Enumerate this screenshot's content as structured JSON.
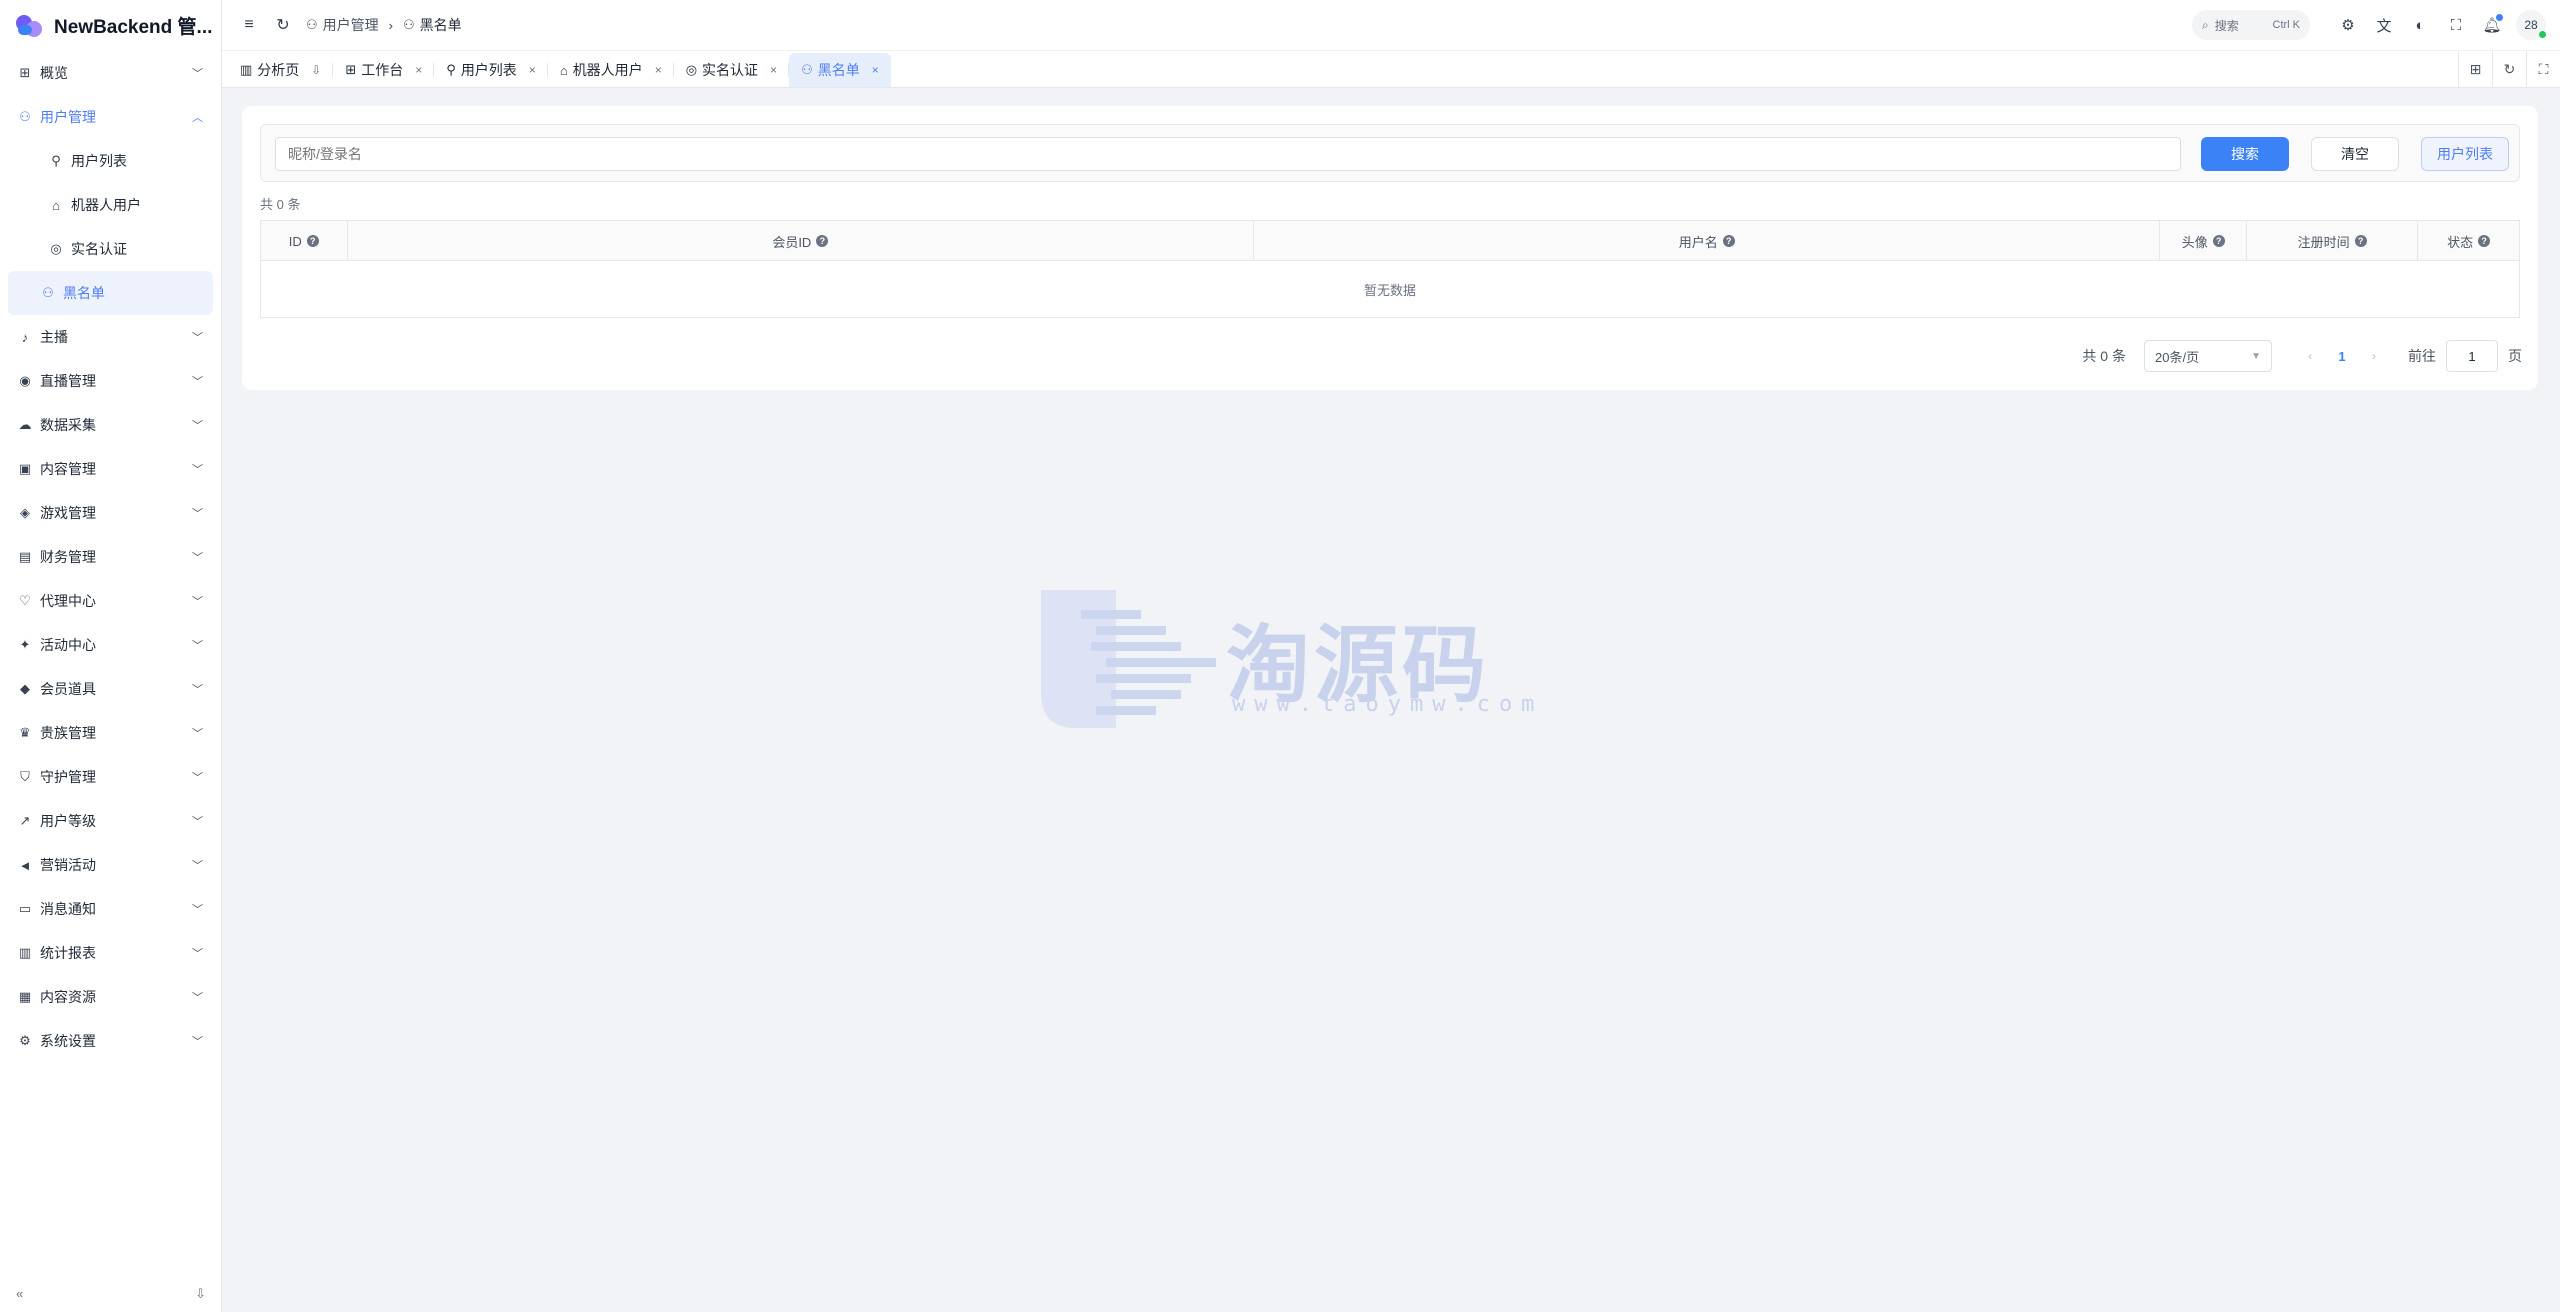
{
  "app": {
    "title": "NewBackend 管..."
  },
  "sidebar": {
    "items": [
      {
        "label": "概览",
        "icon": "⊞",
        "icon_name": "dashboard-icon",
        "name": "overview"
      },
      {
        "label": "用户管理",
        "icon": "⚇",
        "icon_name": "user-icon",
        "name": "user-management",
        "open": true,
        "children": [
          {
            "label": "用户列表",
            "icon": "⚲",
            "icon_name": "user-list-icon",
            "name": "user-list"
          },
          {
            "label": "机器人用户",
            "icon": "⌂",
            "icon_name": "robot-icon",
            "name": "robot-users"
          },
          {
            "label": "实名认证",
            "icon": "◎",
            "icon_name": "verify-icon",
            "name": "real-name-auth"
          },
          {
            "label": "黑名单",
            "icon": "⚇",
            "icon_name": "blacklist-icon",
            "name": "blacklist",
            "active": true
          }
        ]
      },
      {
        "label": "主播",
        "icon": "♪",
        "icon_name": "mic-icon",
        "name": "anchor"
      },
      {
        "label": "直播管理",
        "icon": "◉",
        "icon_name": "broadcast-icon",
        "name": "live-management"
      },
      {
        "label": "数据采集",
        "icon": "☁",
        "icon_name": "cloud-icon",
        "name": "data-collection"
      },
      {
        "label": "内容管理",
        "icon": "▣",
        "icon_name": "content-icon",
        "name": "content-management"
      },
      {
        "label": "游戏管理",
        "icon": "◈",
        "icon_name": "gamepad-icon",
        "name": "game-management"
      },
      {
        "label": "财务管理",
        "icon": "▤",
        "icon_name": "wallet-icon",
        "name": "finance-management"
      },
      {
        "label": "代理中心",
        "icon": "♡",
        "icon_name": "handshake-icon",
        "name": "agent-center"
      },
      {
        "label": "活动中心",
        "icon": "✦",
        "icon_name": "sparkle-icon",
        "name": "activity-center"
      },
      {
        "label": "会员道具",
        "icon": "◆",
        "icon_name": "diamond-icon",
        "name": "member-props"
      },
      {
        "label": "贵族管理",
        "icon": "♛",
        "icon_name": "crown-icon",
        "name": "noble-management"
      },
      {
        "label": "守护管理",
        "icon": "⛉",
        "icon_name": "shield-icon",
        "name": "guard-management"
      },
      {
        "label": "用户等级",
        "icon": "↗",
        "icon_name": "trend-icon",
        "name": "user-level"
      },
      {
        "label": "营销活动",
        "icon": "◄",
        "icon_name": "megaphone-icon",
        "name": "marketing"
      },
      {
        "label": "消息通知",
        "icon": "▭",
        "icon_name": "message-icon",
        "name": "notifications"
      },
      {
        "label": "统计报表",
        "icon": "▥",
        "icon_name": "chart-icon",
        "name": "statistics"
      },
      {
        "label": "内容资源",
        "icon": "▦",
        "icon_name": "resource-icon",
        "name": "content-resources"
      },
      {
        "label": "系统设置",
        "icon": "⚙",
        "icon_name": "settings-icon",
        "name": "system-settings"
      }
    ],
    "footer": {
      "collapse_icon": "«",
      "pin_icon": "⇩"
    }
  },
  "header": {
    "breadcrumb": [
      {
        "label": "用户管理",
        "icon": "⚇"
      },
      {
        "label": "黑名单",
        "icon": "⚇"
      }
    ],
    "search": {
      "label": "搜索",
      "shortcut": "Ctrl K"
    },
    "avatar_text": "28"
  },
  "tabs": [
    {
      "label": "分析页",
      "icon": "▥",
      "icon_name": "chart-icon",
      "close": "⇩",
      "closeable": false
    },
    {
      "label": "工作台",
      "icon": "⊞",
      "icon_name": "workbench-icon",
      "close": "×"
    },
    {
      "label": "用户列表",
      "icon": "⚲",
      "icon_name": "user-icon",
      "close": "×"
    },
    {
      "label": "机器人用户",
      "icon": "⌂",
      "icon_name": "robot-icon",
      "close": "×"
    },
    {
      "label": "实名认证",
      "icon": "◎",
      "icon_name": "verify-icon",
      "close": "×"
    },
    {
      "label": "黑名单",
      "icon": "⚇",
      "icon_name": "blacklist-icon",
      "close": "×",
      "active": true
    }
  ],
  "filter": {
    "placeholder": "昵称/登录名",
    "search_label": "搜索",
    "clear_label": "清空",
    "user_list_label": "用户列表"
  },
  "table": {
    "count_label": "共 0 条",
    "columns": [
      "ID",
      "会员ID",
      "用户名",
      "头像",
      "注册时间",
      "状态"
    ],
    "empty_text": "暂无数据"
  },
  "pagination": {
    "total_label": "共 0 条",
    "page_size": "20条/页",
    "current_page": "1",
    "goto_label": "前往",
    "goto_value": "1",
    "page_suffix": "页"
  },
  "watermark": {
    "text": "淘源码",
    "url": "www.taoymw.com"
  }
}
